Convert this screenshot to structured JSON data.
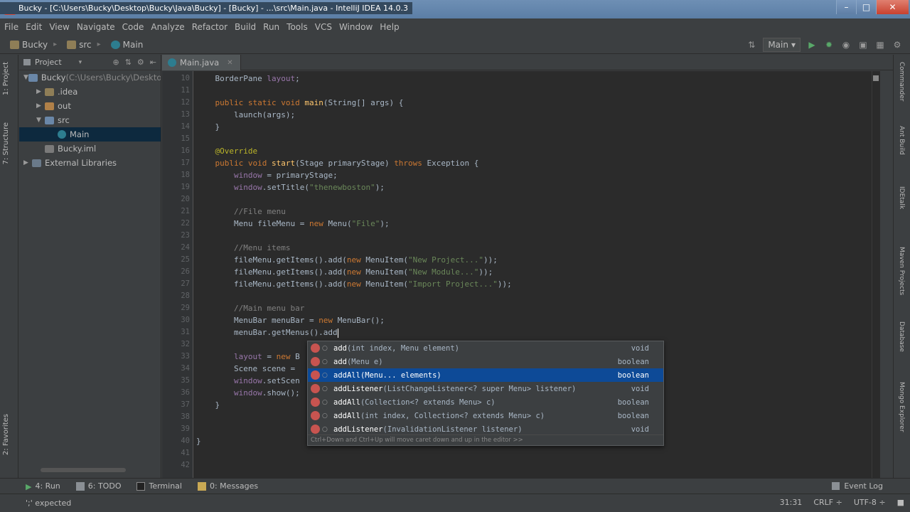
{
  "window": {
    "title": "Bucky - [C:\\Users\\Bucky\\Desktop\\Bucky\\Java\\Bucky] - [Bucky] - ...\\src\\Main.java - IntelliJ IDEA 14.0.3"
  },
  "menu": [
    "File",
    "Edit",
    "View",
    "Navigate",
    "Code",
    "Analyze",
    "Refactor",
    "Build",
    "Run",
    "Tools",
    "VCS",
    "Window",
    "Help"
  ],
  "breadcrumbs": [
    "Bucky",
    "src",
    "Main"
  ],
  "run_config": "Main",
  "left_tabs": {
    "project": "1: Project",
    "structure": "7: Structure",
    "favorites": "2: Favorites"
  },
  "right_tabs": [
    "Commander",
    "Ant Build",
    "IDEtalk",
    "Maven Projects",
    "Database",
    "Mongo Explorer"
  ],
  "project_panel": {
    "header": "Project",
    "tree": [
      {
        "label": "Bucky",
        "suffix": " (C:\\Users\\Bucky\\Deskto",
        "indent": 0,
        "arrow": "▼",
        "icon": "fold blue"
      },
      {
        "label": ".idea",
        "indent": 1,
        "arrow": "▶",
        "icon": "fold"
      },
      {
        "label": "out",
        "indent": 1,
        "arrow": "▶",
        "icon": "fold orange"
      },
      {
        "label": "src",
        "indent": 1,
        "arrow": "▼",
        "icon": "fold blue"
      },
      {
        "label": "Main",
        "indent": 2,
        "arrow": "",
        "icon": "cls",
        "selected": true
      },
      {
        "label": "Bucky.iml",
        "indent": 1,
        "arrow": "",
        "icon": "xml"
      },
      {
        "label": "External Libraries",
        "indent": 0,
        "arrow": "▶",
        "icon": "lib"
      }
    ]
  },
  "editor": {
    "tab": "Main.java",
    "line_numbers": [
      "10",
      "11",
      "12",
      "13",
      "14",
      "15",
      "16",
      "17",
      "18",
      "19",
      "20",
      "21",
      "22",
      "23",
      "24",
      "25",
      "26",
      "27",
      "28",
      "29",
      "30",
      "31",
      "32",
      "33",
      "34",
      "35",
      "36",
      "37",
      "38",
      "39",
      "40",
      "41",
      "42"
    ],
    "lines": [
      [
        {
          "t": "    BorderPane "
        },
        {
          "t": "layout",
          "c": "fld"
        },
        {
          "t": ";"
        }
      ],
      [],
      [
        {
          "t": "    "
        },
        {
          "t": "public static void ",
          "c": "kw"
        },
        {
          "t": "main",
          "c": "fn"
        },
        {
          "t": "(String[] args) {"
        }
      ],
      [
        {
          "t": "        launch(args);"
        }
      ],
      [
        {
          "t": "    }"
        }
      ],
      [],
      [
        {
          "t": "    "
        },
        {
          "t": "@Override",
          "c": "ann"
        }
      ],
      [
        {
          "t": "    "
        },
        {
          "t": "public void ",
          "c": "kw"
        },
        {
          "t": "start",
          "c": "fn"
        },
        {
          "t": "(Stage primaryStage) "
        },
        {
          "t": "throws ",
          "c": "kw"
        },
        {
          "t": "Exception {"
        }
      ],
      [
        {
          "t": "        "
        },
        {
          "t": "window",
          "c": "fld"
        },
        {
          "t": " = primaryStage;"
        }
      ],
      [
        {
          "t": "        "
        },
        {
          "t": "window",
          "c": "fld"
        },
        {
          "t": ".setTitle("
        },
        {
          "t": "\"thenewboston\"",
          "c": "str"
        },
        {
          "t": ");"
        }
      ],
      [],
      [
        {
          "t": "        "
        },
        {
          "t": "//File menu",
          "c": "cmt"
        }
      ],
      [
        {
          "t": "        Menu fileMenu = "
        },
        {
          "t": "new ",
          "c": "kw"
        },
        {
          "t": "Menu("
        },
        {
          "t": "\"File\"",
          "c": "str"
        },
        {
          "t": ");"
        }
      ],
      [],
      [
        {
          "t": "        "
        },
        {
          "t": "//Menu items",
          "c": "cmt"
        }
      ],
      [
        {
          "t": "        fileMenu.getItems().add("
        },
        {
          "t": "new ",
          "c": "kw"
        },
        {
          "t": "MenuItem("
        },
        {
          "t": "\"New Project...\"",
          "c": "str"
        },
        {
          "t": "));"
        }
      ],
      [
        {
          "t": "        fileMenu.getItems().add("
        },
        {
          "t": "new ",
          "c": "kw"
        },
        {
          "t": "MenuItem("
        },
        {
          "t": "\"New Module...\"",
          "c": "str"
        },
        {
          "t": "));"
        }
      ],
      [
        {
          "t": "        fileMenu.getItems().add("
        },
        {
          "t": "new ",
          "c": "kw"
        },
        {
          "t": "MenuItem("
        },
        {
          "t": "\"Import Project...\"",
          "c": "str"
        },
        {
          "t": "));"
        }
      ],
      [],
      [
        {
          "t": "        "
        },
        {
          "t": "//Main menu bar",
          "c": "cmt"
        }
      ],
      [
        {
          "t": "        MenuBar menuBar = "
        },
        {
          "t": "new ",
          "c": "kw"
        },
        {
          "t": "MenuBar();"
        }
      ],
      [
        {
          "t": "        menuBar.getMenus().add"
        },
        {
          "cursor": true
        }
      ],
      [],
      [
        {
          "t": "        "
        },
        {
          "t": "layout",
          "c": "fld"
        },
        {
          "t": " = "
        },
        {
          "t": "new ",
          "c": "kw"
        },
        {
          "t": "B"
        }
      ],
      [
        {
          "t": "        Scene scene = "
        }
      ],
      [
        {
          "t": "        "
        },
        {
          "t": "window",
          "c": "fld"
        },
        {
          "t": ".setScen"
        }
      ],
      [
        {
          "t": "        "
        },
        {
          "t": "window",
          "c": "fld"
        },
        {
          "t": ".show();"
        }
      ],
      [
        {
          "t": "    }"
        }
      ],
      [],
      [],
      [
        {
          "t": "}"
        }
      ],
      [],
      []
    ]
  },
  "completion": {
    "items": [
      {
        "name": "add",
        "sig": "(int index, Menu element)",
        "type": "void"
      },
      {
        "name": "add",
        "sig": "(Menu e)",
        "type": "boolean"
      },
      {
        "name": "addAll",
        "sig": "(Menu... elements)",
        "type": "boolean",
        "selected": true
      },
      {
        "name": "addListener",
        "sig": "(ListChangeListener<? super Menu> listener)",
        "type": "void"
      },
      {
        "name": "addAll",
        "sig": "(Collection<? extends Menu> c)",
        "type": "boolean"
      },
      {
        "name": "addAll",
        "sig": "(int index, Collection<? extends Menu> c)",
        "type": "boolean"
      },
      {
        "name": "addListener",
        "sig": "(InvalidationListener listener)",
        "type": "void"
      }
    ],
    "hint": "Ctrl+Down and Ctrl+Up will move caret down and up in the editor  >>"
  },
  "bottom_tools": [
    {
      "label": "4: Run",
      "icon": "run"
    },
    {
      "label": "6: TODO",
      "icon": "todo"
    },
    {
      "label": "Terminal",
      "icon": "term"
    },
    {
      "label": "0: Messages",
      "icon": "msg"
    }
  ],
  "event_log": "Event Log",
  "status": {
    "message": "';' expected",
    "position": "31:31",
    "line_sep": "CRLF ÷",
    "encoding": "UTF-8 ÷"
  }
}
